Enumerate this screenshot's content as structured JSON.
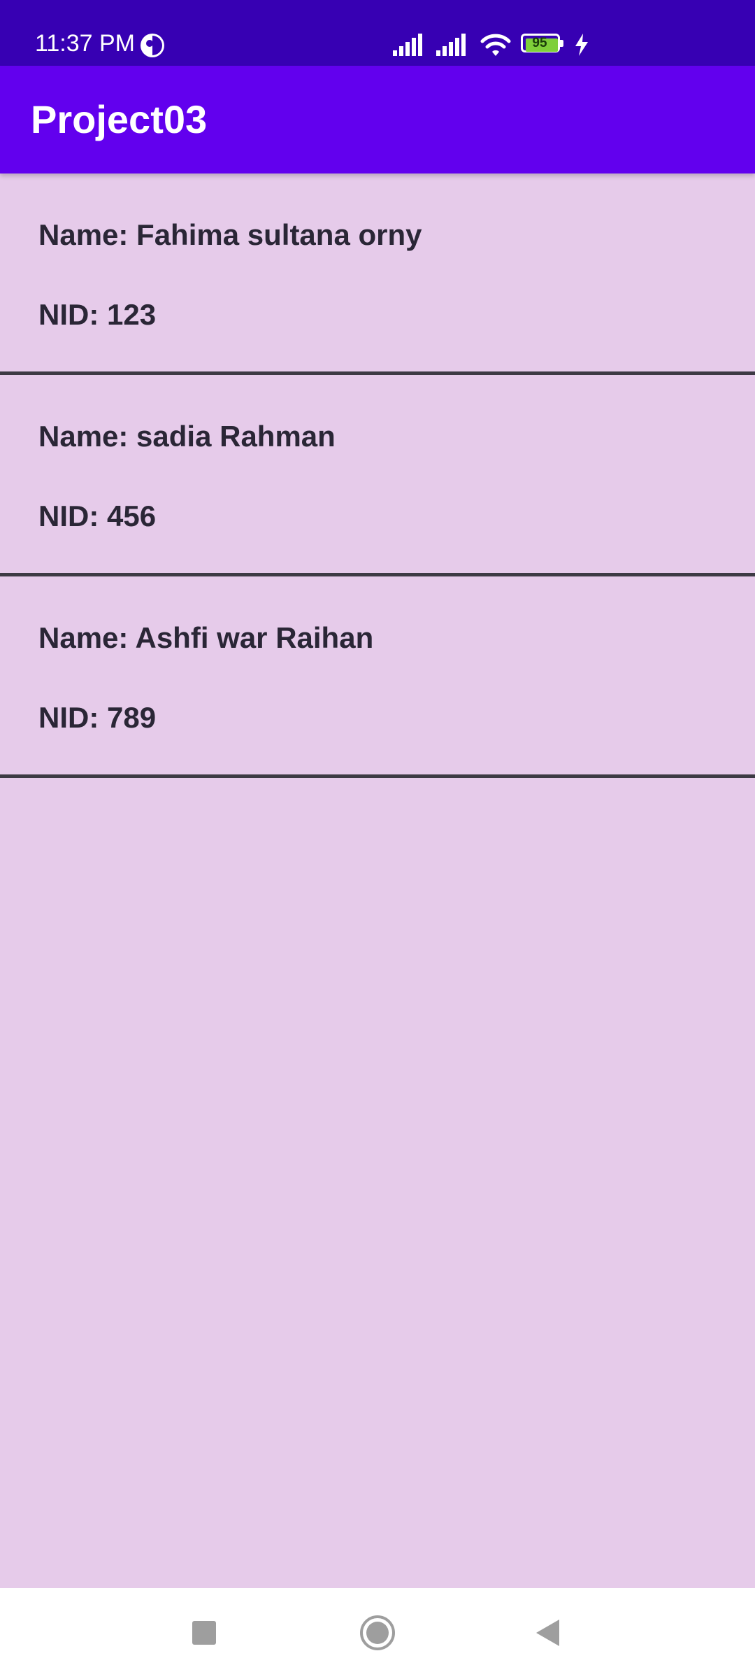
{
  "status_bar": {
    "time": "11:37 PM",
    "battery_level": "95",
    "icons": [
      "app-notification-icon",
      "signal-icon",
      "signal-icon",
      "wifi-icon",
      "battery-icon",
      "charging-icon"
    ]
  },
  "app_bar": {
    "title": "Project03"
  },
  "list": {
    "items": [
      {
        "name": "Name: Fahima sultana orny",
        "nid": "NID: 123"
      },
      {
        "name": "Name: sadia Rahman",
        "nid": "NID: 456"
      },
      {
        "name": "Name: Ashfi war Raihan",
        "nid": "NID: 789"
      }
    ]
  },
  "nav_bar": {
    "buttons": [
      "recents-button",
      "home-button",
      "back-button"
    ]
  },
  "colors": {
    "status_bar": "#3700b3",
    "app_bar": "#6200ee",
    "background": "#e6cbea",
    "divider": "#3d3a44",
    "text": "#2a2636"
  }
}
